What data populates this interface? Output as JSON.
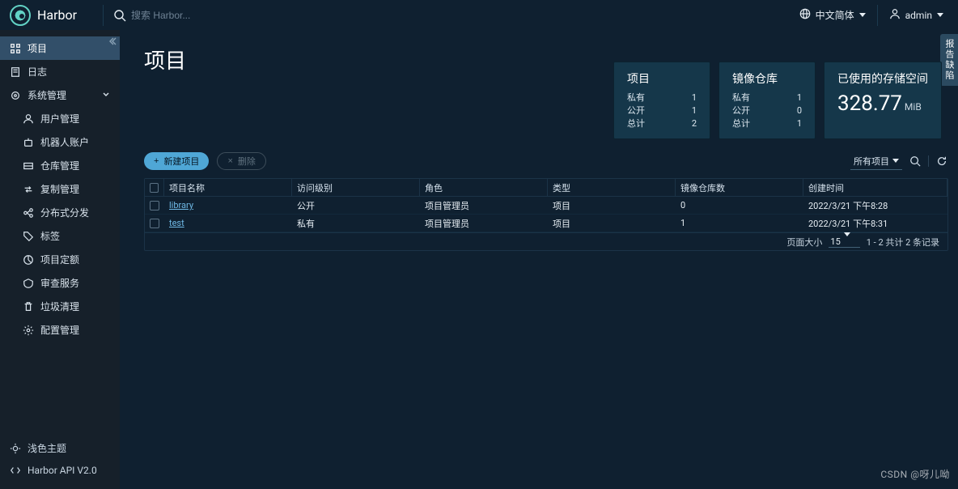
{
  "top": {
    "brand": "Harbor",
    "search_placeholder": "搜索 Harbor...",
    "lang": "中文简体",
    "user": "admin"
  },
  "feedback_tab": "报告缺陷",
  "sidebar": {
    "projects": "项目",
    "logs": "日志",
    "system": "系统管理",
    "user_mgmt": "用户管理",
    "robot": "机器人账户",
    "repo": "仓库管理",
    "replication": "复制管理",
    "distribution": "分布式分发",
    "labels": "标签",
    "quota": "项目定额",
    "audit": "审查服务",
    "gc": "垃圾清理",
    "config": "配置管理",
    "theme": "浅色主题",
    "api": "Harbor API V2.0"
  },
  "page": {
    "title": "项目"
  },
  "cards": {
    "projects": {
      "title": "项目",
      "private_label": "私有",
      "private_val": "1",
      "public_label": "公开",
      "public_val": "1",
      "total_label": "总计",
      "total_val": "2"
    },
    "repos": {
      "title": "镜像仓库",
      "private_label": "私有",
      "private_val": "1",
      "public_label": "公开",
      "public_val": "0",
      "total_label": "总计",
      "total_val": "1"
    },
    "storage": {
      "title": "已使用的存储空间",
      "value": "328.77",
      "unit": "MiB"
    }
  },
  "toolbar": {
    "new": "新建项目",
    "delete": "删除",
    "filter_label": "所有项目"
  },
  "table": {
    "headers": {
      "name": "项目名称",
      "access": "访问级别",
      "role": "角色",
      "type": "类型",
      "repo_count": "镜像仓库数",
      "created": "创建时间"
    },
    "rows": [
      {
        "name": "library",
        "access": "公开",
        "role": "项目管理员",
        "type": "项目",
        "repo": "0",
        "created": "2022/3/21 下午8:28",
        "link": true
      },
      {
        "name": "test",
        "access": "私有",
        "role": "项目管理员",
        "type": "项目",
        "repo": "1",
        "created": "2022/3/21 下午8:31",
        "link": true
      }
    ],
    "footer": {
      "page_size_label": "页面大小",
      "page_size_value": "15",
      "range": "1 - 2 共计 2 条记录"
    }
  },
  "watermark": "CSDN @呀儿呦"
}
